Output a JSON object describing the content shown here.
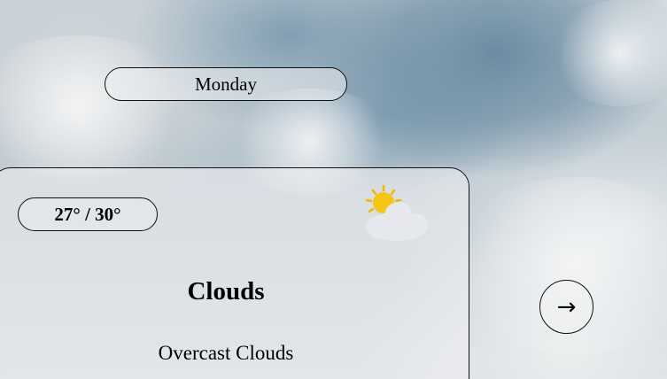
{
  "day": {
    "label": "Monday"
  },
  "forecast": {
    "temperature_range": "27° / 30°",
    "condition": "Clouds",
    "description": "Overcast Clouds",
    "icon": "partly-cloudy-icon"
  },
  "navigation": {
    "next_symbol": "→"
  },
  "colors": {
    "sun": "#f5c518",
    "sun_rays": "#f2b705",
    "cloud": "#e6e8ee",
    "border": "#111111"
  }
}
